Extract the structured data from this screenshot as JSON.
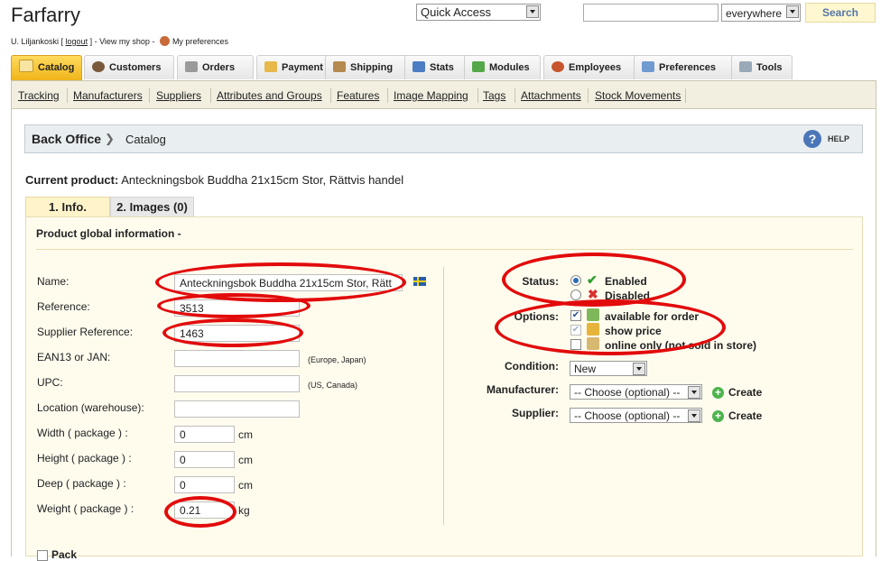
{
  "header": {
    "shop_title": "Farfarry",
    "user_name": "U. Liljankoski",
    "logout_label": "logout",
    "view_shop_label": "View my shop",
    "preferences_label": "My preferences",
    "quick_access": "Quick Access",
    "search_value": "",
    "search_scope": "everywhere",
    "search_button": "Search"
  },
  "tabs": [
    {
      "label": "Catalog",
      "icon": "folder-icon",
      "active": true
    },
    {
      "label": "Customers",
      "icon": "customers-icon"
    },
    {
      "label": "Orders",
      "icon": "orders-icon"
    },
    {
      "label": "Payment",
      "icon": "payment-icon"
    },
    {
      "label": "Shipping",
      "icon": "truck-icon"
    },
    {
      "label": "Stats",
      "icon": "stats-icon"
    },
    {
      "label": "Modules",
      "icon": "puzzle-icon"
    },
    {
      "label": "Employees",
      "icon": "employees-icon"
    },
    {
      "label": "Preferences",
      "icon": "preferences-icon"
    },
    {
      "label": "Tools",
      "icon": "wrench-icon"
    }
  ],
  "subnav": [
    "Tracking",
    "Manufacturers",
    "Suppliers",
    "Attributes and Groups",
    "Features",
    "Image Mapping",
    "Tags",
    "Attachments",
    "Stock Movements"
  ],
  "breadcrumb": {
    "home": "Back Office",
    "current": "Catalog",
    "help": "HELP"
  },
  "product": {
    "current_label": "Current product:",
    "current_name": "Anteckningsbok Buddha 21x15cm Stor, Rättvis handel",
    "tab_info": "1. Info.",
    "tab_images": "2. Images (0)",
    "section_title": "Product global information -"
  },
  "form": {
    "name_label": "Name:",
    "name_value": "Anteckningsbok Buddha 21x15cm Stor, Rätt",
    "reference_label": "Reference:",
    "reference_value": "3513",
    "supplier_ref_label": "Supplier Reference:",
    "supplier_ref_value": "1463",
    "ean_label": "EAN13 or JAN:",
    "ean_value": "",
    "ean_hint": "(Europe, Japan)",
    "upc_label": "UPC:",
    "upc_value": "",
    "upc_hint": "(US, Canada)",
    "location_label": "Location (warehouse):",
    "location_value": "",
    "width_label": "Width ( package ) :",
    "width_value": "0",
    "height_label": "Height ( package ) :",
    "height_value": "0",
    "deep_label": "Deep ( package ) :",
    "deep_value": "0",
    "weight_label": "Weight ( package ) :",
    "weight_value": "0.21",
    "unit_cm": "cm",
    "unit_kg": "kg",
    "pack_label": "Pack"
  },
  "right": {
    "status_label": "Status:",
    "enabled": "Enabled",
    "disabled": "Disabled",
    "options_label": "Options:",
    "opt_available": "available for order",
    "opt_show_price": "show price",
    "opt_online_only": "online only (not sold in store)",
    "condition_label": "Condition:",
    "condition_value": "New",
    "manufacturer_label": "Manufacturer:",
    "manufacturer_value": "-- Choose (optional) --",
    "supplier_label": "Supplier:",
    "supplier_value": "-- Choose (optional) --",
    "create_label": "Create"
  },
  "colors": {
    "annotation": "#e20b0b",
    "active_tab": "#f0b419",
    "panel_bg": "#fffcee"
  }
}
